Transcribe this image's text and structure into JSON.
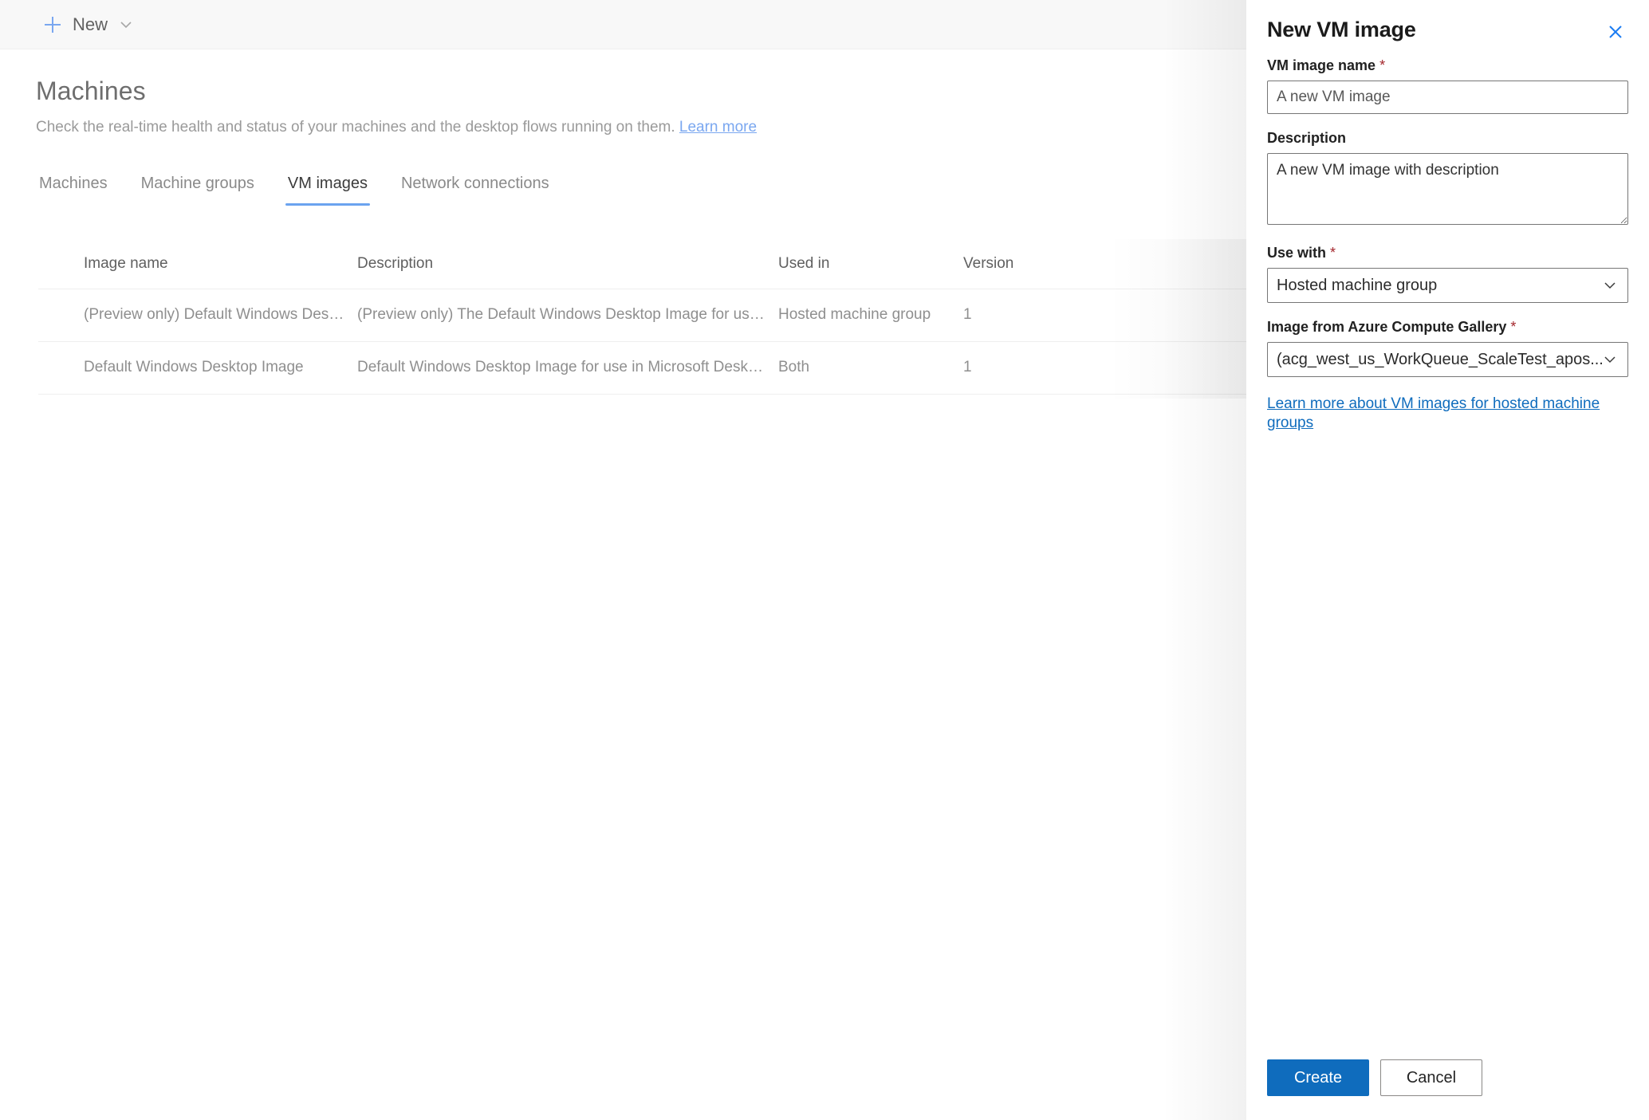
{
  "command_bar": {
    "new_button_label": "New",
    "plus_icon": "plus-icon",
    "chevron_icon": "chevron-down-icon"
  },
  "page": {
    "title": "Machines",
    "subtitle": "Check the real-time health and status of your machines and the desktop flows running on them.",
    "learn_more_label": "Learn more"
  },
  "tabs": [
    {
      "label": "Machines",
      "selected": false
    },
    {
      "label": "Machine groups",
      "selected": false
    },
    {
      "label": "VM images",
      "selected": true
    },
    {
      "label": "Network connections",
      "selected": false
    }
  ],
  "table": {
    "columns": [
      "Image name",
      "Description",
      "Used in",
      "Version"
    ],
    "rows": [
      {
        "image_name": "(Preview only) Default Windows Desktop Ima...",
        "description": "(Preview only) The Default Windows Desktop Image for use i...",
        "used_in": "Hosted machine group",
        "version": "1"
      },
      {
        "image_name": "Default Windows Desktop Image",
        "description": "Default Windows Desktop Image for use in Microsoft Deskto...",
        "used_in": "Both",
        "version": "1"
      }
    ]
  },
  "panel": {
    "title": "New VM image",
    "close_icon": "close-icon",
    "fields": {
      "vm_image_name": {
        "label": "VM image name",
        "required": true,
        "value": "A new VM image"
      },
      "description": {
        "label": "Description",
        "required": false,
        "value": "A new VM image with description"
      },
      "use_with": {
        "label": "Use with",
        "required": true,
        "selected": "Hosted machine group",
        "chevron_icon": "chevron-down-icon"
      },
      "image_from_gallery": {
        "label": "Image from Azure Compute Gallery",
        "required": true,
        "selected": "(acg_west_us_WorkQueue_ScaleTest_apos...",
        "chevron_icon": "chevron-down-icon"
      }
    },
    "learn_link_label": "Learn more about VM images for hosted machine groups",
    "create_button_label": "Create",
    "cancel_button_label": "Cancel"
  },
  "colors": {
    "accent_blue": "#0f6cbd",
    "link_blue": "#0f6cbd",
    "tab_underline": "#6ba3ef",
    "required_red": "#a4262c",
    "command_bar_bg": "#f8f8f8"
  }
}
